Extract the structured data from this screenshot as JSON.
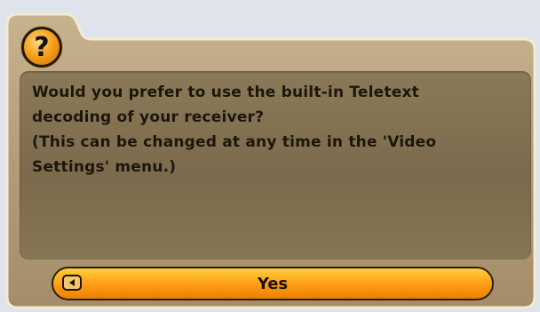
{
  "dialog": {
    "icon": "question-icon",
    "icon_glyph": "?",
    "message_lines": [
      "Would you prefer to use the built-in Teletext",
      "decoding of your receiver?",
      "(This can be changed at any time in the 'Video",
      "Settings' menu.)"
    ],
    "yes_button": {
      "label": "Yes",
      "key_icon": "left-arrow-key-icon"
    }
  },
  "colors": {
    "panel": "#b8a27d",
    "message_area": "#807050",
    "button": "#ffa31a",
    "text": "#1c160c"
  }
}
